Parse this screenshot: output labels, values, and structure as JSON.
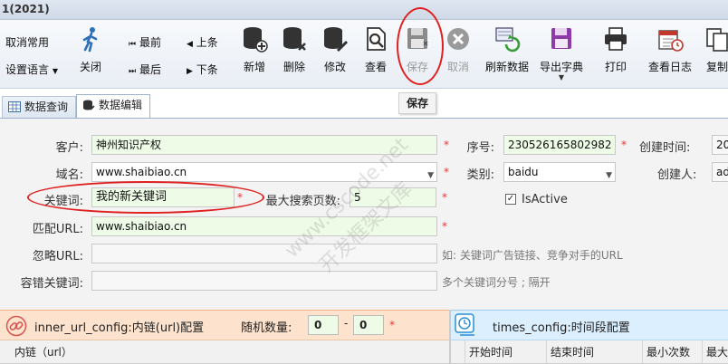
{
  "window": {
    "title": "1(2021)"
  },
  "toolbar": {
    "cancel_common": "取消常用",
    "set_language": "设置语言",
    "close": "关闭",
    "first": "最前",
    "last": "最后",
    "prev": "上条",
    "next": "下条",
    "add": "新增",
    "delete": "删除",
    "edit": "修改",
    "view": "查看",
    "save": "保存",
    "cancel": "取消",
    "refresh": "刷新数据",
    "export_dict": "导出字典",
    "print": "打印",
    "view_log": "查看日志",
    "copy": "复制"
  },
  "tooltip": {
    "text": "保存"
  },
  "tabs": [
    {
      "label": "数据查询"
    },
    {
      "label": "数据编辑"
    }
  ],
  "form": {
    "customer_label": "客户:",
    "customer_value": "神州知识产权",
    "serial_label": "序号:",
    "serial_value": "230526165802982",
    "created_time_label": "创建时间:",
    "created_time_value": "20",
    "domain_label": "域名:",
    "domain_value": "www.shaibiao.cn",
    "category_label": "类别:",
    "category_value": "baidu",
    "creator_label": "创建人:",
    "creator_value": "ad",
    "keyword_label": "关键词:",
    "keyword_value": "我的新关键词",
    "max_pages_label": "最大搜索页数:",
    "max_pages_value": "5",
    "isactive_label": "IsActive",
    "isactive_checked": true,
    "match_url_label": "匹配URL:",
    "match_url_value": "www.shaibiao.cn",
    "ignore_url_label": "忽略URL:",
    "ignore_url_value": "",
    "ignore_url_hint": "如: 关键词广告链接、竞争对手的URL",
    "fault_kw_label": "容错关键词:",
    "fault_kw_value": "",
    "fault_kw_hint": "多个关键词分号 ; 隔开",
    "required_mark": "*"
  },
  "inner_panel": {
    "title": "inner_url_config:内链(url)配置",
    "random_label": "随机数量:",
    "random_min": "0",
    "random_sep": "-",
    "random_max": "0",
    "required_mark": "*",
    "columns": [
      "内链（url）"
    ]
  },
  "times_panel": {
    "title": "times_config:时间段配置",
    "columns": [
      "开始时间",
      "结束时间",
      "最小次数",
      "最大"
    ]
  },
  "watermark": {
    "line1": "www.cscode.net",
    "line2": "开发框架文库"
  },
  "colors": {
    "required": "#e33333",
    "annotation": "#e02020",
    "input_bg": "#eefbe6"
  }
}
